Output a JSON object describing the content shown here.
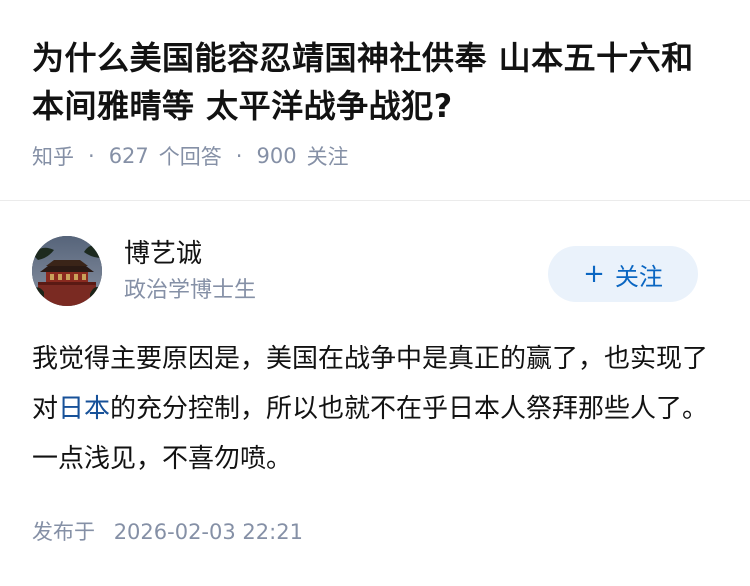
{
  "question": {
    "title": "为什么美国能容忍靖国神社供奉 山本五十六和本间雅晴等 太平洋战争战犯?",
    "source": "知乎",
    "answers_count": "627",
    "answers_label": "个回答",
    "followers_count": "900",
    "followers_label": "关注"
  },
  "author": {
    "name": "博艺诚",
    "bio": "政治学博士生",
    "follow_icon": "+",
    "follow_label": "关注"
  },
  "answer": {
    "text_before_link": "我觉得主要原因是，美国在战争中是真正的赢了，也实现了对",
    "link_text": "日本",
    "text_after_link": "的充分控制，所以也就不在乎日本人祭拜那些人了。一点浅见，不喜勿喷。"
  },
  "publish": {
    "label": "发布于",
    "datetime": "2026-02-03 22:21"
  },
  "colors": {
    "meta_gray": "#8590a6",
    "link_blue": "#175199",
    "follow_bg": "#eaf2fb",
    "follow_text": "#0a66c2"
  }
}
